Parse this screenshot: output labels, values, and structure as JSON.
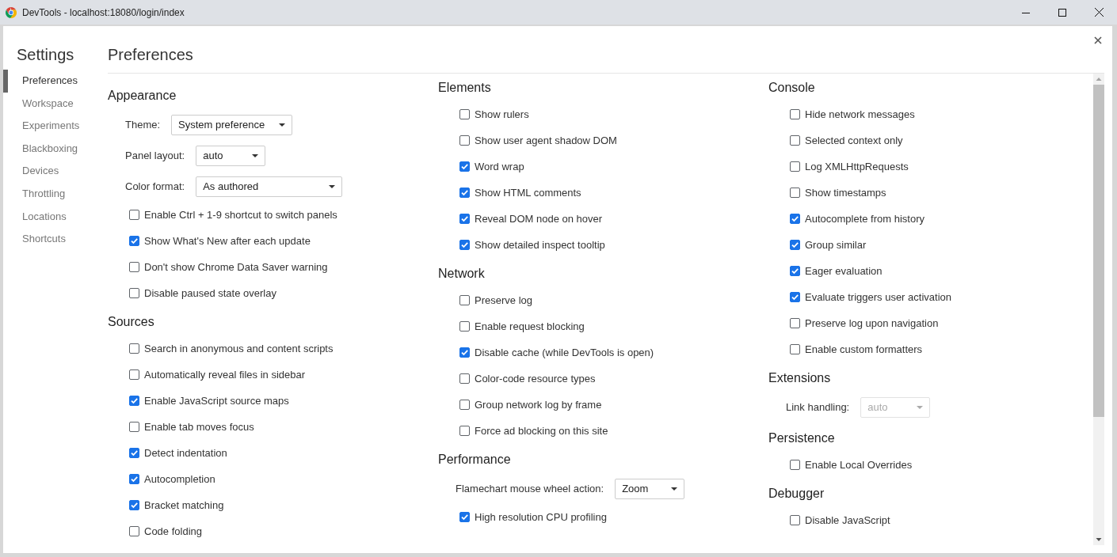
{
  "window": {
    "title": "DevTools - localhost:18080/login/index"
  },
  "sidebar": {
    "title": "Settings",
    "items": [
      {
        "label": "Preferences",
        "selected": true
      },
      {
        "label": "Workspace",
        "selected": false
      },
      {
        "label": "Experiments",
        "selected": false
      },
      {
        "label": "Blackboxing",
        "selected": false
      },
      {
        "label": "Devices",
        "selected": false
      },
      {
        "label": "Throttling",
        "selected": false
      },
      {
        "label": "Locations",
        "selected": false
      },
      {
        "label": "Shortcuts",
        "selected": false
      }
    ]
  },
  "main": {
    "title": "Preferences",
    "columns": [
      {
        "sections": [
          {
            "title": "Appearance",
            "items": [
              {
                "kind": "select",
                "label": "Theme:",
                "value": "System preference",
                "disabled": false
              },
              {
                "kind": "select",
                "label": "Panel layout:",
                "value": "auto",
                "disabled": false
              },
              {
                "kind": "select",
                "label": "Color format:",
                "value": "As authored",
                "disabled": false
              },
              {
                "kind": "checkbox",
                "label": "Enable Ctrl + 1-9 shortcut to switch panels",
                "checked": false
              },
              {
                "kind": "checkbox",
                "label": "Show What's New after each update",
                "checked": true
              },
              {
                "kind": "checkbox",
                "label": "Don't show Chrome Data Saver warning",
                "checked": false
              },
              {
                "kind": "checkbox",
                "label": "Disable paused state overlay",
                "checked": false
              }
            ]
          },
          {
            "title": "Sources",
            "items": [
              {
                "kind": "checkbox",
                "label": "Search in anonymous and content scripts",
                "checked": false
              },
              {
                "kind": "checkbox",
                "label": "Automatically reveal files in sidebar",
                "checked": false
              },
              {
                "kind": "checkbox",
                "label": "Enable JavaScript source maps",
                "checked": true
              },
              {
                "kind": "checkbox",
                "label": "Enable tab moves focus",
                "checked": false
              },
              {
                "kind": "checkbox",
                "label": "Detect indentation",
                "checked": true
              },
              {
                "kind": "checkbox",
                "label": "Autocompletion",
                "checked": true
              },
              {
                "kind": "checkbox",
                "label": "Bracket matching",
                "checked": true
              },
              {
                "kind": "checkbox",
                "label": "Code folding",
                "checked": false
              }
            ]
          }
        ]
      },
      {
        "sections": [
          {
            "title": "Elements",
            "items": [
              {
                "kind": "checkbox",
                "label": "Show rulers",
                "checked": false
              },
              {
                "kind": "checkbox",
                "label": "Show user agent shadow DOM",
                "checked": false
              },
              {
                "kind": "checkbox",
                "label": "Word wrap",
                "checked": true
              },
              {
                "kind": "checkbox",
                "label": "Show HTML comments",
                "checked": true
              },
              {
                "kind": "checkbox",
                "label": "Reveal DOM node on hover",
                "checked": true
              },
              {
                "kind": "checkbox",
                "label": "Show detailed inspect tooltip",
                "checked": true
              }
            ]
          },
          {
            "title": "Network",
            "items": [
              {
                "kind": "checkbox",
                "label": "Preserve log",
                "checked": false
              },
              {
                "kind": "checkbox",
                "label": "Enable request blocking",
                "checked": false
              },
              {
                "kind": "checkbox",
                "label": "Disable cache (while DevTools is open)",
                "checked": true
              },
              {
                "kind": "checkbox",
                "label": "Color-code resource types",
                "checked": false
              },
              {
                "kind": "checkbox",
                "label": "Group network log by frame",
                "checked": false
              },
              {
                "kind": "checkbox",
                "label": "Force ad blocking on this site",
                "checked": false
              }
            ]
          },
          {
            "title": "Performance",
            "items": [
              {
                "kind": "select",
                "label": "Flamechart mouse wheel action:",
                "value": "Zoom",
                "disabled": false
              },
              {
                "kind": "checkbox",
                "label": "High resolution CPU profiling",
                "checked": true
              }
            ]
          }
        ]
      },
      {
        "sections": [
          {
            "title": "Console",
            "items": [
              {
                "kind": "checkbox",
                "label": "Hide network messages",
                "checked": false
              },
              {
                "kind": "checkbox",
                "label": "Selected context only",
                "checked": false
              },
              {
                "kind": "checkbox",
                "label": "Log XMLHttpRequests",
                "checked": false
              },
              {
                "kind": "checkbox",
                "label": "Show timestamps",
                "checked": false
              },
              {
                "kind": "checkbox",
                "label": "Autocomplete from history",
                "checked": true
              },
              {
                "kind": "checkbox",
                "label": "Group similar",
                "checked": true
              },
              {
                "kind": "checkbox",
                "label": "Eager evaluation",
                "checked": true
              },
              {
                "kind": "checkbox",
                "label": "Evaluate triggers user activation",
                "checked": true
              },
              {
                "kind": "checkbox",
                "label": "Preserve log upon navigation",
                "checked": false
              },
              {
                "kind": "checkbox",
                "label": "Enable custom formatters",
                "checked": false
              }
            ]
          },
          {
            "title": "Extensions",
            "items": [
              {
                "kind": "select",
                "label": "Link handling:",
                "value": "auto",
                "disabled": true
              }
            ]
          },
          {
            "title": "Persistence",
            "items": [
              {
                "kind": "checkbox",
                "label": "Enable Local Overrides",
                "checked": false
              }
            ]
          },
          {
            "title": "Debugger",
            "items": [
              {
                "kind": "checkbox",
                "label": "Disable JavaScript",
                "checked": false
              }
            ]
          }
        ]
      }
    ]
  }
}
